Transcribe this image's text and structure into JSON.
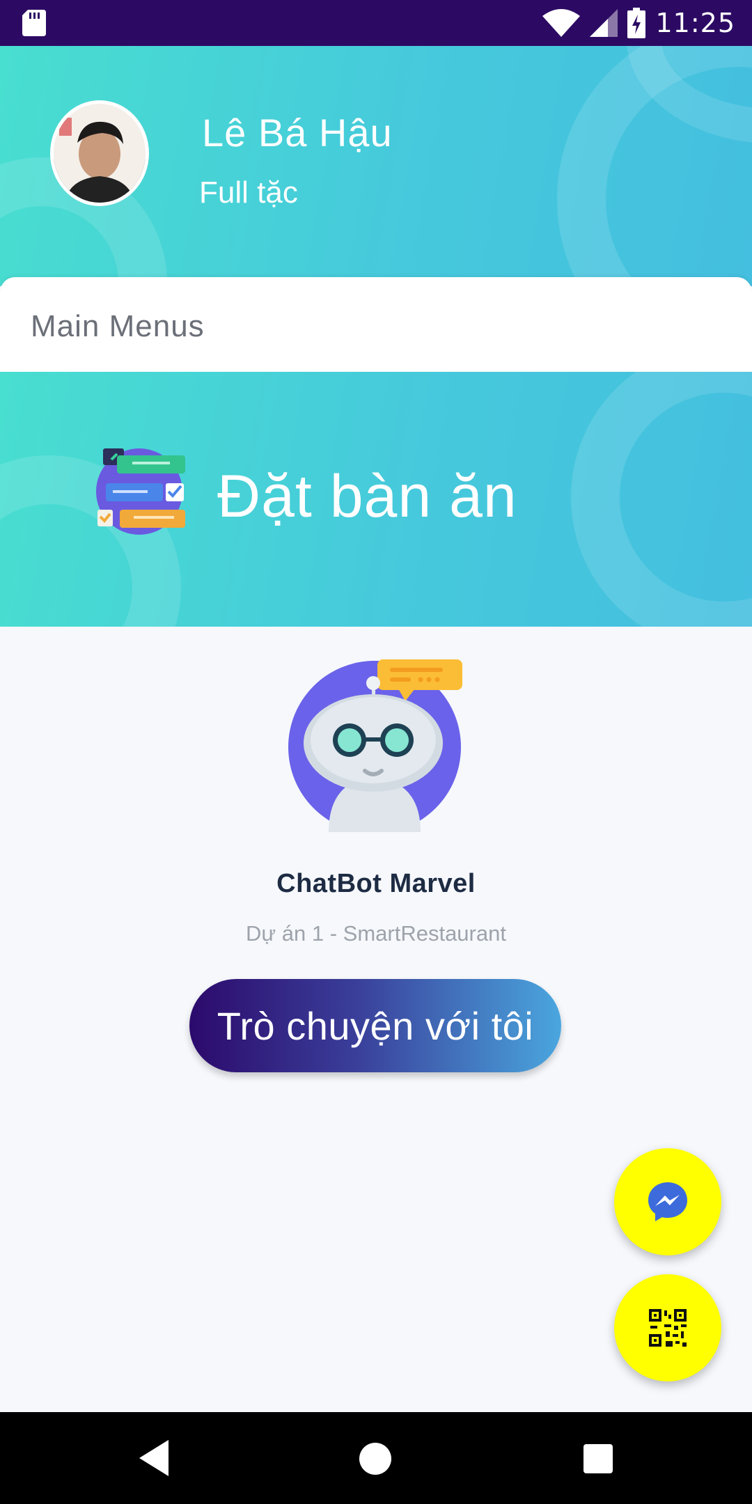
{
  "status_bar": {
    "time": "11:25",
    "icons": [
      "sd-card-icon",
      "wifi-icon",
      "signal-icon",
      "battery-charging-icon"
    ],
    "background": "#2c0a63"
  },
  "header": {
    "user_name": "Lê Bá Hậu",
    "user_subtitle": "Full tặc",
    "gradient": [
      "#48ded0",
      "#44bfdf"
    ]
  },
  "menus": {
    "title": "Main Menus"
  },
  "booking": {
    "label": "Đặt bàn ăn",
    "icon": "booking-list-icon"
  },
  "chatbot": {
    "name": "ChatBot Marvel",
    "subtitle": "Dự án 1 - SmartRestaurant",
    "button_label": "Trò chuyện với tôi",
    "icon": "robot-avatar-icon"
  },
  "fabs": [
    {
      "icon": "messenger-icon",
      "color": "#ffff00"
    },
    {
      "icon": "qr-code-icon",
      "color": "#ffff00"
    }
  ],
  "nav_bar": {
    "icons": [
      "back-icon",
      "home-icon",
      "recent-apps-icon"
    ]
  }
}
